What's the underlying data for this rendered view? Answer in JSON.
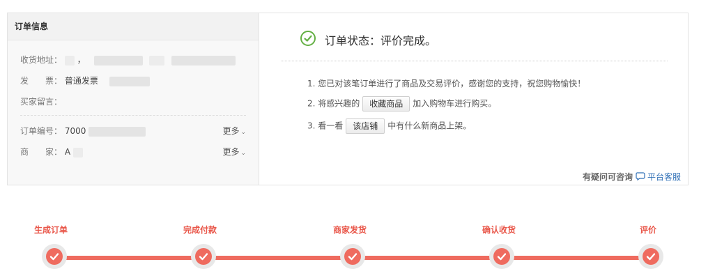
{
  "order_info": {
    "title": "订单信息",
    "address_label": "收货地址：",
    "address_value": "，",
    "invoice_label": "发　　票：",
    "invoice_value": "普通发票",
    "message_label": "买家留言：",
    "order_no_label": "订单编号：",
    "order_no_value": "7000",
    "more_label": "更多",
    "seller_label": "商　　家：",
    "seller_value": "A",
    "more_label_2": "更多"
  },
  "status": {
    "text": "订单状态：评价完成。",
    "tip1": "1. 您已对该笔订单进行了商品及交易评价，感谢您的支持，祝您购物愉快！",
    "tip2_before": "2. 将感兴趣的",
    "tip2_button": "收藏商品",
    "tip2_after": "加入购物车进行购买。",
    "tip3_before": "3. 看一看",
    "tip3_button": "该店铺",
    "tip3_after": "中有什么新商品上架。",
    "help_question": "有疑问可咨询",
    "help_service": "平台客服"
  },
  "steps": [
    {
      "label": "生成订单"
    },
    {
      "label": "完成付款"
    },
    {
      "label": "商家发货"
    },
    {
      "label": "确认收货"
    },
    {
      "label": "评价"
    }
  ],
  "colors": {
    "step_accent": "#ef6b5f",
    "status_green": "#64b044",
    "link_blue": "#2f6fb6"
  }
}
